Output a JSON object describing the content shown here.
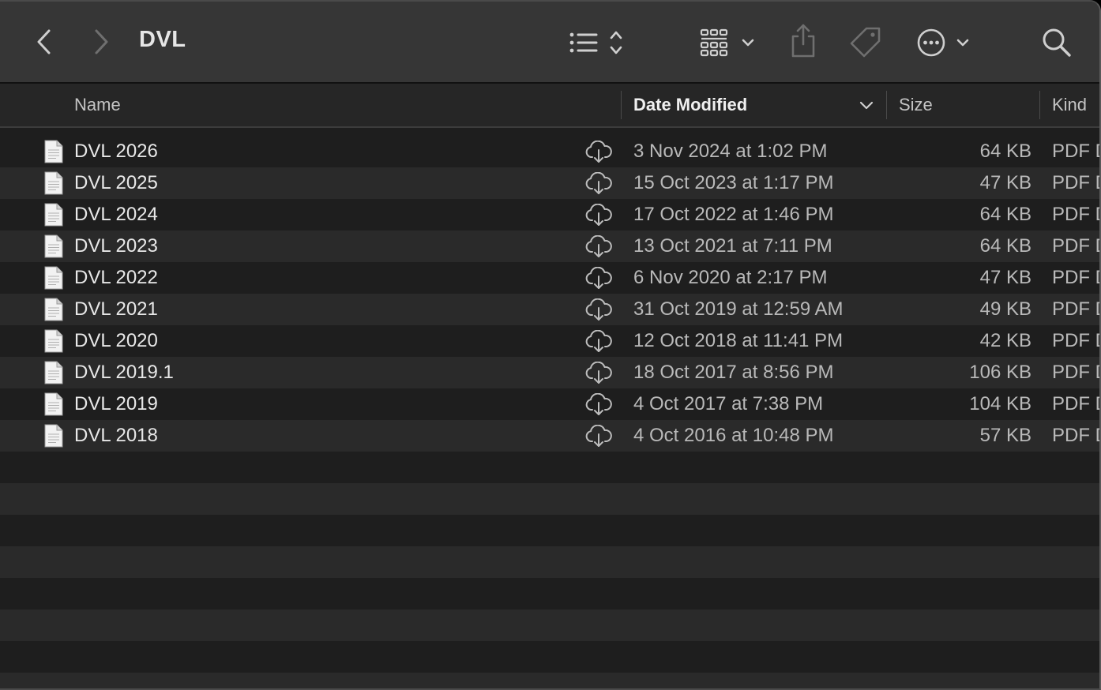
{
  "window": {
    "title": "DVL"
  },
  "toolbar": {
    "back_icon": "chevron-left-icon",
    "forward_icon": "chevron-right-icon",
    "view_icon": "list-view-icon",
    "group_icon": "grid-group-icon",
    "share_icon": "share-icon",
    "tag_icon": "tag-icon",
    "more_icon": "ellipsis-circle-icon",
    "search_icon": "search-icon"
  },
  "columns": {
    "name": "Name",
    "date_modified": "Date Modified",
    "size": "Size",
    "kind": "Kind",
    "sorted_by": "Date Modified"
  },
  "files": [
    {
      "name": "DVL 2026",
      "date": "3 Nov 2024 at 1:02 PM",
      "size": "64 KB",
      "kind": "PDF D"
    },
    {
      "name": "DVL 2025",
      "date": "15 Oct 2023 at 1:17 PM",
      "size": "47 KB",
      "kind": "PDF D"
    },
    {
      "name": "DVL 2024",
      "date": "17 Oct 2022 at 1:46 PM",
      "size": "64 KB",
      "kind": "PDF D"
    },
    {
      "name": "DVL 2023",
      "date": "13 Oct 2021 at 7:11 PM",
      "size": "64 KB",
      "kind": "PDF D"
    },
    {
      "name": "DVL 2022",
      "date": "6 Nov 2020 at 2:17 PM",
      "size": "47 KB",
      "kind": "PDF D"
    },
    {
      "name": "DVL 2021",
      "date": "31 Oct 2019 at 12:59 AM",
      "size": "49 KB",
      "kind": "PDF D"
    },
    {
      "name": "DVL 2020",
      "date": "12 Oct 2018 at 11:41 PM",
      "size": "42 KB",
      "kind": "PDF D"
    },
    {
      "name": "DVL 2019.1",
      "date": "18 Oct 2017 at 8:56 PM",
      "size": "106 KB",
      "kind": "PDF D"
    },
    {
      "name": "DVL 2019",
      "date": "4 Oct 2017 at 7:38 PM",
      "size": "104 KB",
      "kind": "PDF D"
    },
    {
      "name": "DVL 2018",
      "date": "4 Oct 2016 at 10:48 PM",
      "size": "57 KB",
      "kind": "PDF D"
    }
  ],
  "colors": {
    "toolbar_bg": "#363636",
    "list_bg": "#1e1e1e",
    "row_alt_bg": "#2a2a2a",
    "text_primary": "#e8e8e8",
    "text_secondary": "#b9b9b9"
  }
}
